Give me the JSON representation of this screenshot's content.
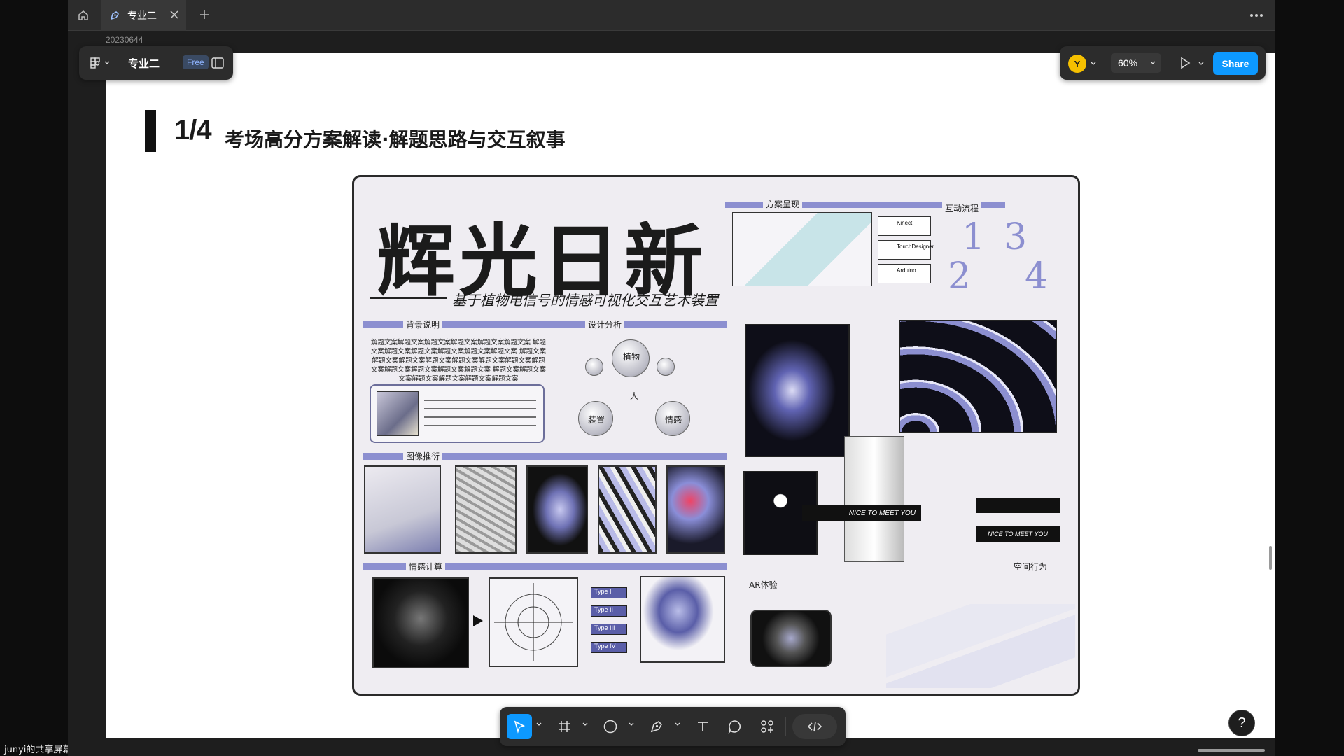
{
  "system": {
    "share_label": "junyi的共享屏幕"
  },
  "tabs": [
    {
      "label": "专业二",
      "active": true
    }
  ],
  "frame_label": "20230644",
  "file": {
    "name": "专业二",
    "plan_badge": "Free"
  },
  "header_right": {
    "avatar_initial": "Y",
    "zoom": "60%",
    "share_label": "Share"
  },
  "slide": {
    "index": "1/4",
    "title": "考场高分方案解读·解题思路与交互叙事"
  },
  "poster": {
    "title": "辉光日新",
    "subtitle": "基于植物电信号的情感可视化交互艺术装置",
    "sections": {
      "background": "背景说明",
      "design_analysis": "设计分析",
      "imagery": "图像推衍",
      "emotion": "情感计算",
      "scheme": "方案呈现",
      "interaction": "互动流程",
      "ar": "AR体验",
      "space": "空间行为"
    },
    "body_lines": [
      "解题文案解题文案解题文案解题文案解题文案解题文案 解题",
      "文案解题文案解题文案解题文案解题文案解题文案 解题文案",
      "解题文案解题文案解题文案解题文案解题文案解题文案解题",
      "文案解题文案解题文案解题文案解题文案 解题文案解题文案",
      "文案解题文案解题文案解题文案解题文案"
    ],
    "triad": [
      "植物",
      "人",
      "装置",
      "情感"
    ],
    "nice_to_meet_you": "NICE TO MEET YOU",
    "types": [
      "Type I",
      "Type II",
      "Type III",
      "Type IV"
    ],
    "numbers": [
      "1",
      "3",
      "2",
      "4"
    ],
    "devices": [
      "Kinect",
      "TouchDesigner",
      "Arduino"
    ]
  },
  "colors": {
    "accent": "#0d99ff",
    "band": "#8c8fd0"
  }
}
